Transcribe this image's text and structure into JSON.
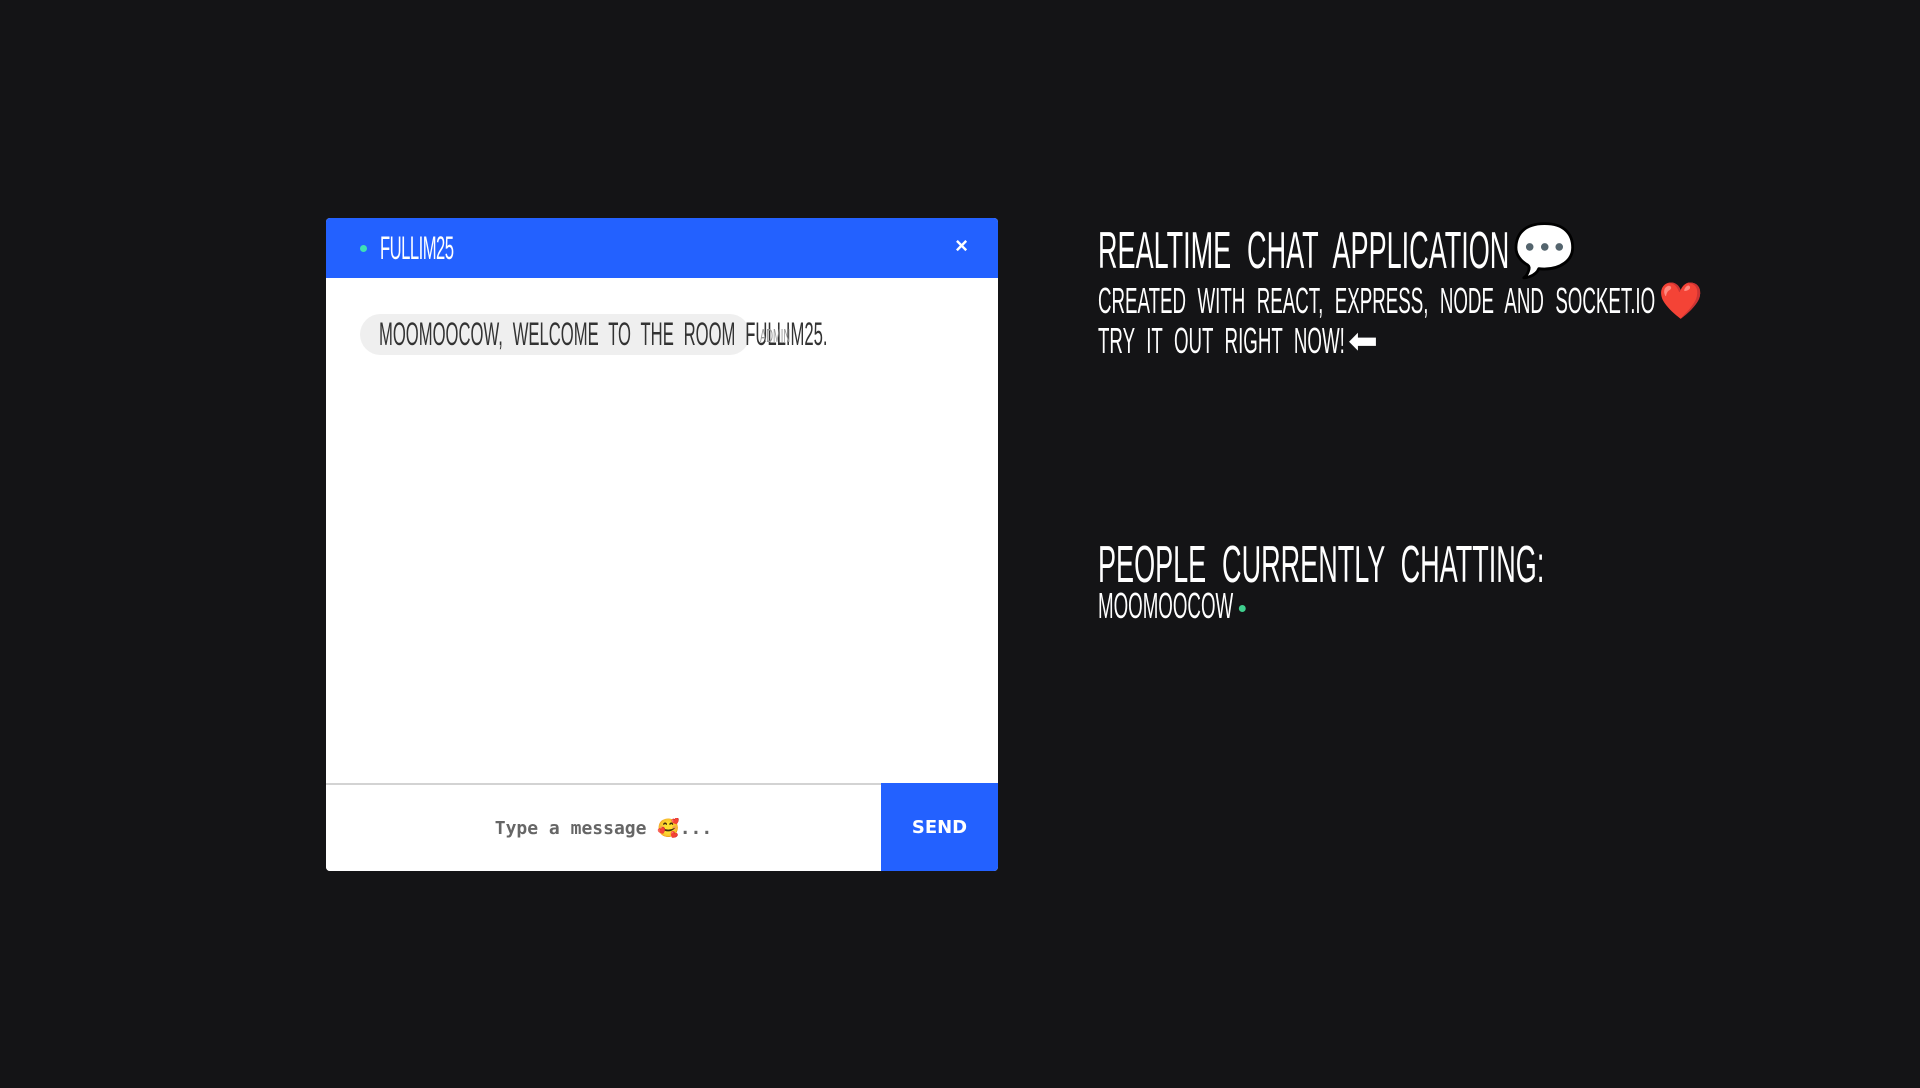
{
  "chat": {
    "room_name": "fullim25",
    "close_icon": "×",
    "messages": [
      {
        "text": "moomoocow, welcome to the room fullim25.",
        "sender": "admin"
      }
    ],
    "input_placeholder": "Type a message 🥰...",
    "input_value": "",
    "send_label": "SEND"
  },
  "info": {
    "title": "Realtime Chat Application",
    "title_emoji": "💬",
    "subtitle": "Created with React, Express, Node and Socket.IO",
    "subtitle_emoji": "❤️",
    "cta": "Try it out right now!",
    "cta_emoji": "⬅",
    "people_heading": "People currently chatting:",
    "people": [
      "moomoocow"
    ]
  },
  "colors": {
    "accent": "#2361ff",
    "online": "#3fcf8e",
    "background": "#141416"
  }
}
